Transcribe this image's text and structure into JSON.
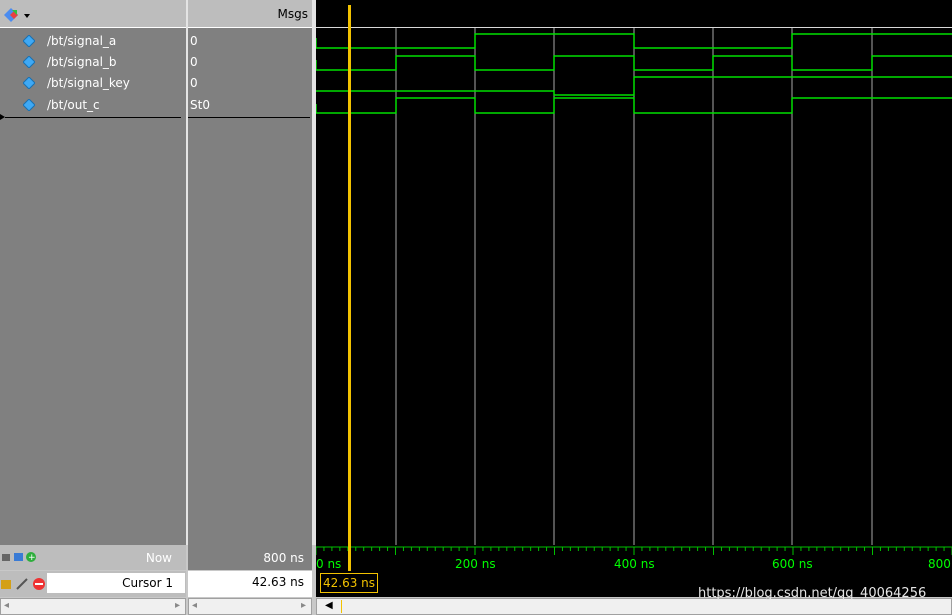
{
  "header": {
    "msgs_label": "Msgs"
  },
  "signals": [
    {
      "name": "/bt/signal_a",
      "value": "0"
    },
    {
      "name": "/bt/signal_b",
      "value": "0"
    },
    {
      "name": "/bt/signal_key",
      "value": "0"
    },
    {
      "name": "/bt/out_c",
      "value": "St0"
    }
  ],
  "status": {
    "now_label": "Now",
    "now_value": "800 ns",
    "cursor_label": "Cursor 1",
    "cursor_value": "42.63 ns",
    "cursor_tag": "42.63 ns"
  },
  "timeline": {
    "ticks": [
      "0 ns",
      "200 ns",
      "400 ns",
      "600 ns",
      "800"
    ]
  },
  "waves": {
    "signal_a": [
      [
        0,
        1
      ],
      [
        200,
        1
      ],
      [
        400,
        1
      ],
      [
        600,
        1
      ]
    ],
    "colors": {
      "wave": "#00ff00",
      "cursor": "#ffd700",
      "grid": "#b0b0b0"
    }
  },
  "watermark": "https://blog.csdn.net/qq_40064256"
}
